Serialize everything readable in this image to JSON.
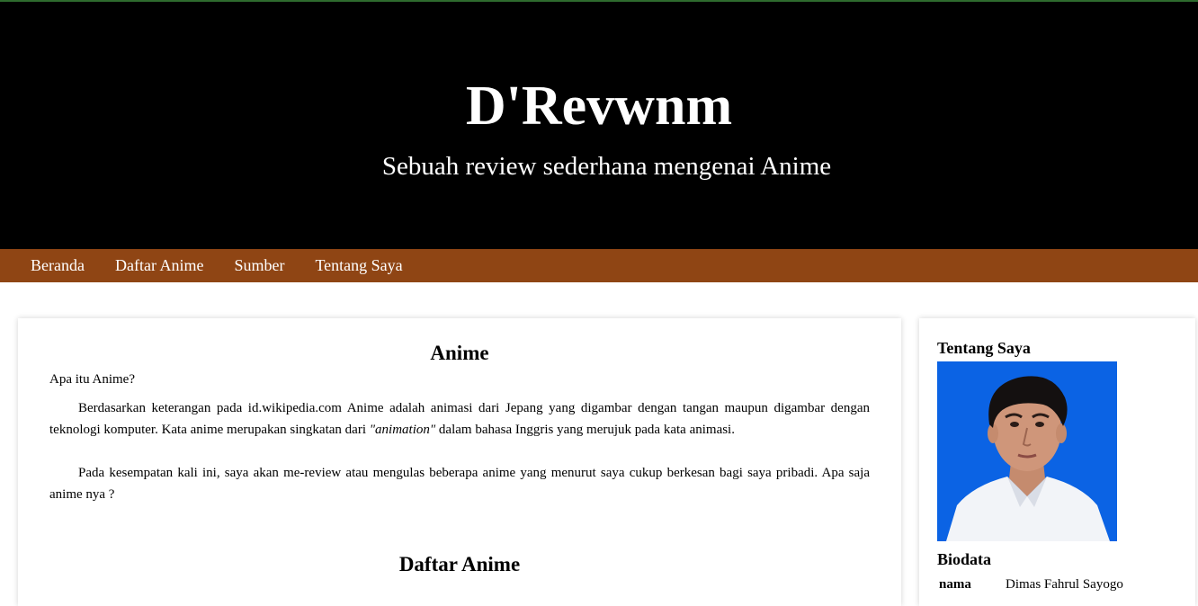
{
  "header": {
    "title": "D'Revwnm",
    "tagline": "Sebuah review sederhana mengenai Anime"
  },
  "nav": {
    "items": [
      "Beranda",
      "Daftar Anime",
      "Sumber",
      "Tentang Saya"
    ]
  },
  "main": {
    "section_title": "Anime",
    "question": "Apa itu Anime?",
    "para1_before": "Berdasarkan keterangan pada id.wikipedia.com Anime adalah animasi dari Jepang yang digambar dengan tangan maupun digambar dengan teknologi komputer. Kata anime merupakan singkatan dari ",
    "para1_em": "\"animation\"",
    "para1_after": " dalam bahasa Inggris yang merujuk pada kata animasi.",
    "para2": "Pada kesempatan kali ini, saya akan me-review atau mengulas beberapa anime yang menurut saya cukup berkesan bagi saya pribadi. Apa saja anime nya ?",
    "list_title": "Daftar Anime"
  },
  "sidebar": {
    "title": "Tentang Saya",
    "bio_title": "Biodata",
    "bio": {
      "key": "nama",
      "value": "Dimas Fahrul Sayogo"
    }
  },
  "colors": {
    "header_bg": "#000000",
    "nav_bg": "#8f4514",
    "photo_bg": "#0b63e4"
  }
}
